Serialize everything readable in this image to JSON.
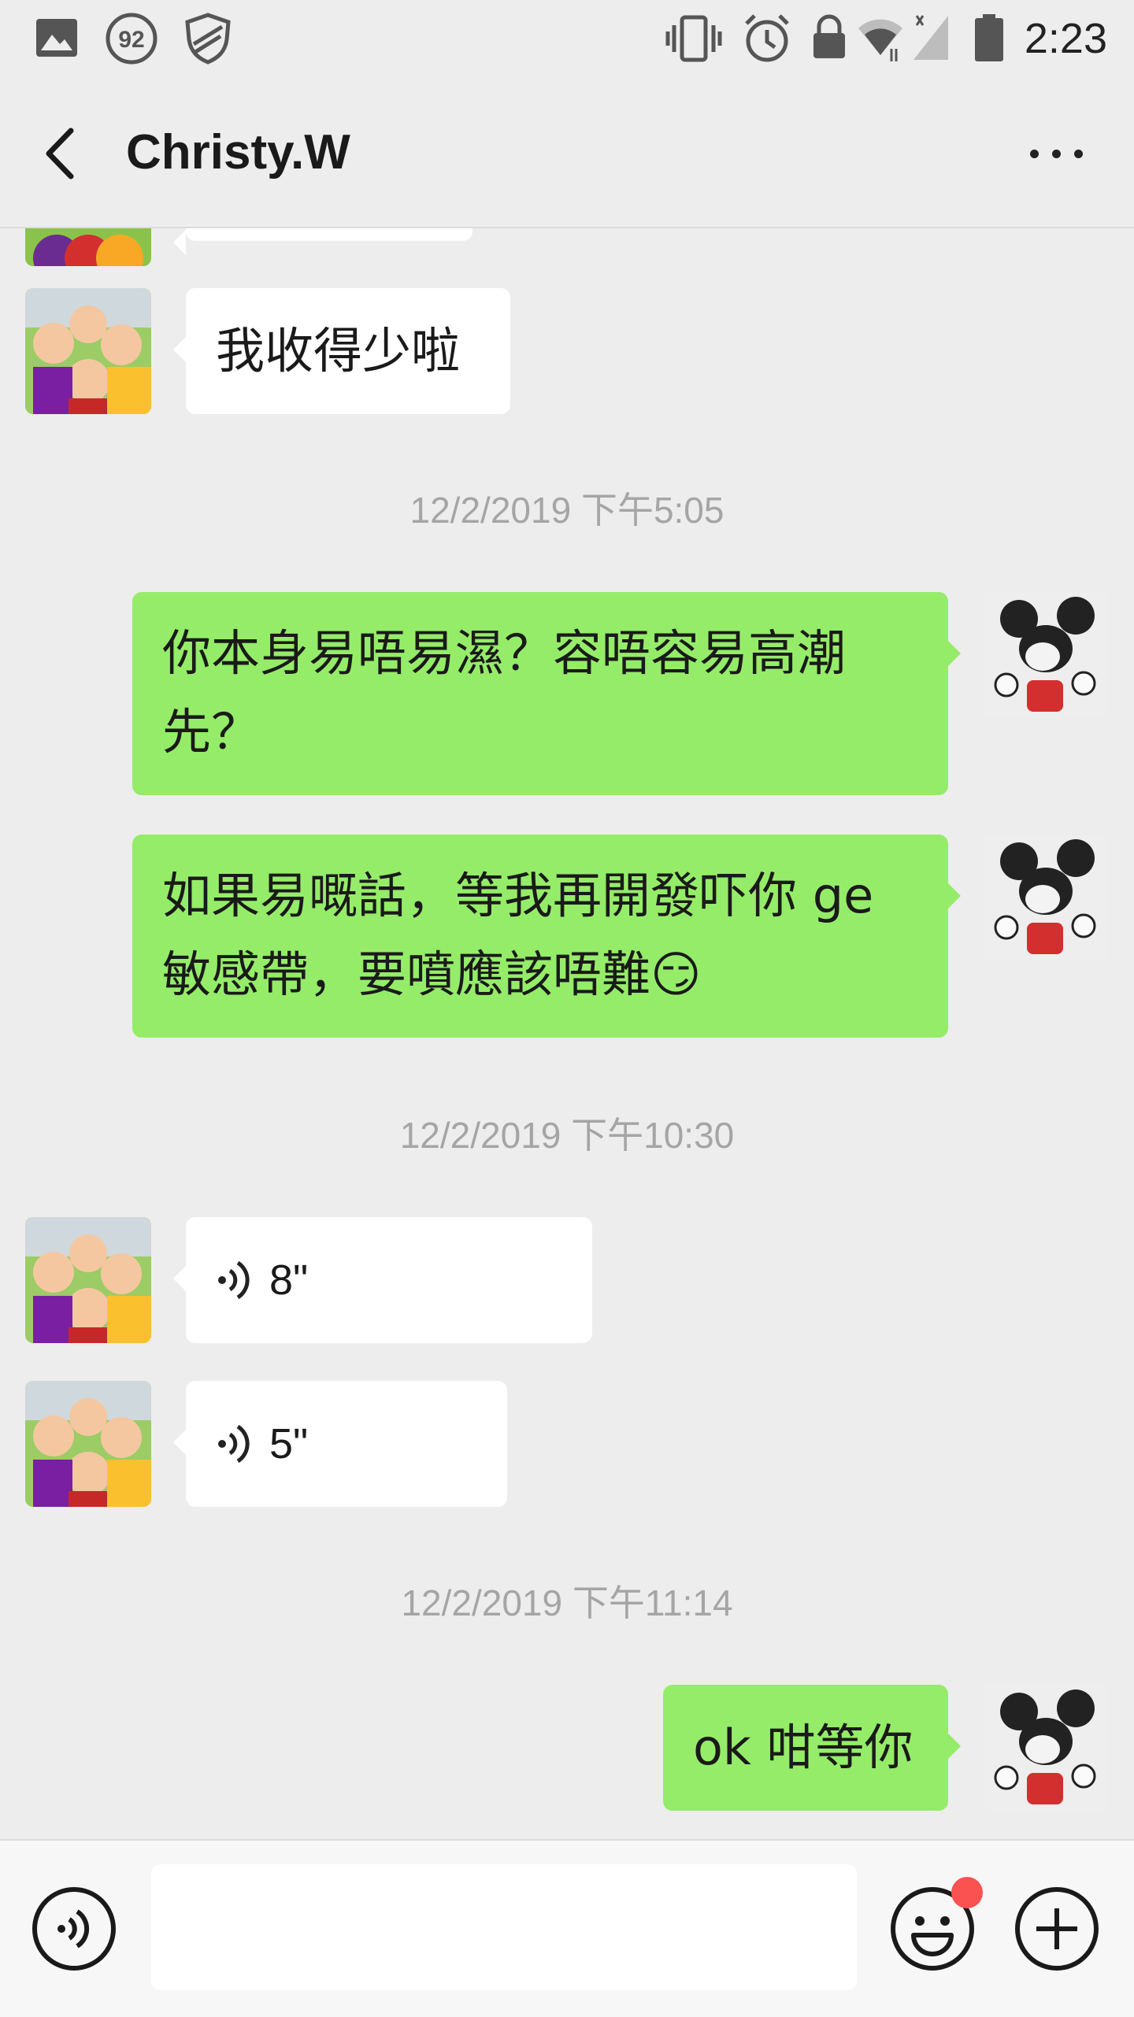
{
  "status_bar": {
    "battery_badge": "92",
    "time": "2:23",
    "icons": [
      "image-icon",
      "battery-saver-icon",
      "shield-icon",
      "vibrate-icon",
      "alarm-icon",
      "lock-icon",
      "wifi-icon",
      "signal-icon",
      "battery-icon"
    ]
  },
  "header": {
    "title": "Christy.W"
  },
  "messages": [
    {
      "type": "text",
      "side": "in",
      "text": "我收得少啦"
    },
    {
      "type": "time",
      "text": "12/2/2019 下午5:05"
    },
    {
      "type": "text",
      "side": "out",
      "line1": "你本身易唔易濕？容唔容易高潮",
      "line2": "先？"
    },
    {
      "type": "text",
      "side": "out",
      "line1": "如果易嘅話，等我再開發吓你 ge",
      "line2": "敏感帶，要噴應該唔難😏"
    },
    {
      "type": "time",
      "text": "12/2/2019 下午10:30"
    },
    {
      "type": "voice",
      "side": "in",
      "duration": "8\""
    },
    {
      "type": "voice",
      "side": "in",
      "duration": "5\""
    },
    {
      "type": "time",
      "text": "12/2/2019 下午11:14"
    },
    {
      "type": "text",
      "side": "out",
      "text": "ok 咁等你"
    }
  ],
  "input": {
    "value": "",
    "placeholder": ""
  },
  "colors": {
    "background": "#ededed",
    "outgoing_bubble": "#95ec69",
    "incoming_bubble": "#ffffff",
    "timestamp": "#a5a5a5",
    "notification_dot": "#fa5151"
  }
}
